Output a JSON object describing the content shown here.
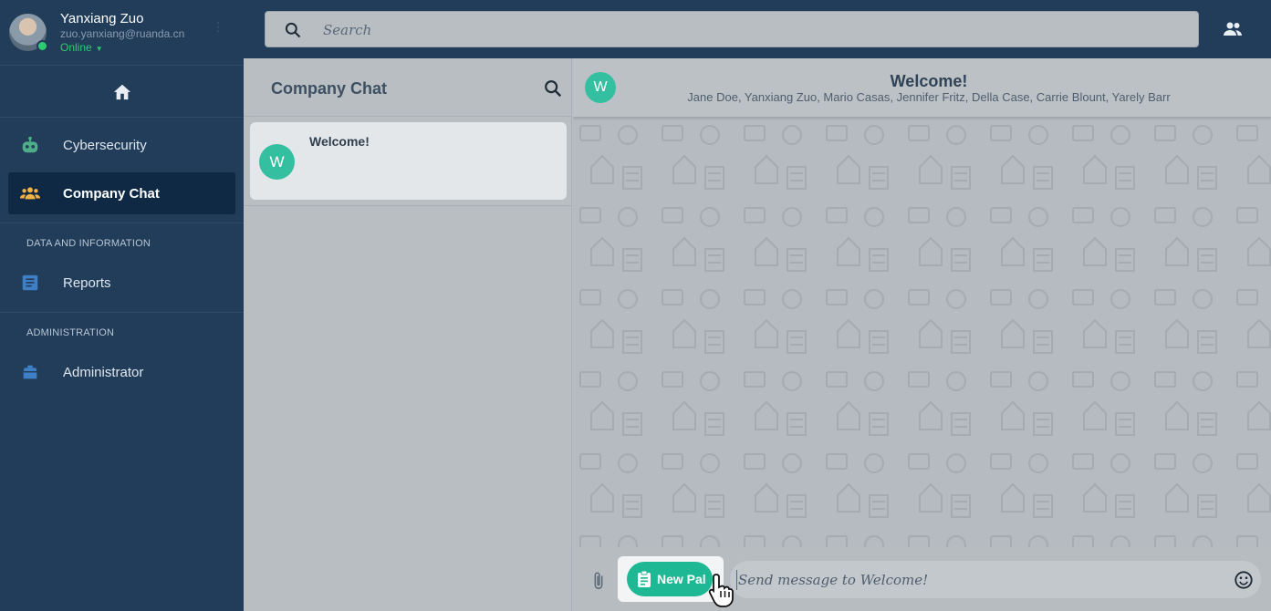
{
  "user": {
    "name": "Yanxiang Zuo",
    "email": "zuo.yanxiang@ruanda.cn",
    "status": "Online"
  },
  "sidebar": {
    "items": [
      {
        "label": "Cybersecurity",
        "icon": "robot-icon"
      },
      {
        "label": "Company Chat",
        "icon": "group-icon",
        "active": true
      }
    ],
    "sections": [
      {
        "title": "DATA AND INFORMATION",
        "items": [
          {
            "label": "Reports",
            "icon": "document-icon"
          }
        ]
      },
      {
        "title": "ADMINISTRATION",
        "items": [
          {
            "label": "Administrator",
            "icon": "admin-icon"
          }
        ]
      }
    ]
  },
  "topbar": {
    "search_placeholder": "Search"
  },
  "chat_list": {
    "title": "Company Chat",
    "chats": [
      {
        "avatar_letter": "W",
        "title": "Welcome!"
      }
    ]
  },
  "conversation": {
    "avatar_letter": "W",
    "title": "Welcome!",
    "members": "Jane Doe, Yanxiang Zuo, Mario Casas, Jennifer Fritz, Della Case, Carrie Blount, Yarely Barr",
    "new_pal_label": "New Pal",
    "message_placeholder": "Send message to Welcome!"
  },
  "colors": {
    "sidebar_bg": "#213d5a",
    "active_item_bg": "#0f2944",
    "accent_green": "#1fb894",
    "avatar_teal": "#34c0a0",
    "status_green": "#2ecc71"
  }
}
